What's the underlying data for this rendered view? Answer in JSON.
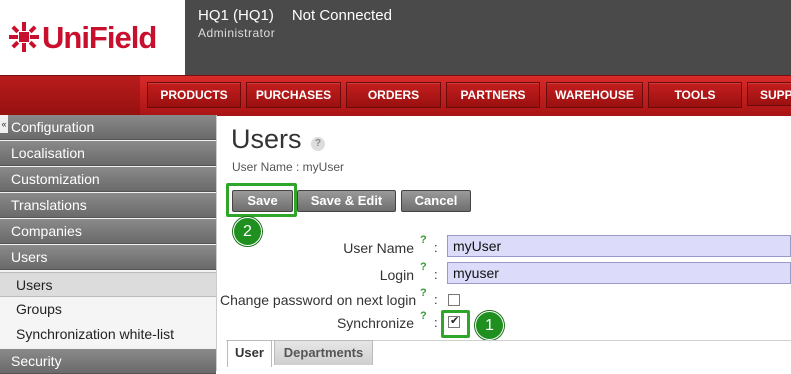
{
  "header": {
    "brand": "UniField",
    "instance": "HQ1 (HQ1)",
    "connection_status": "Not Connected",
    "user": "Administrator",
    "brand_color": "#c8102e"
  },
  "menu": {
    "items": [
      "PRODUCTS",
      "PURCHASES",
      "ORDERS",
      "PARTNERS",
      "WAREHOUSE",
      "TOOLS",
      "SUPP"
    ]
  },
  "sidebar": {
    "collapse_icon": "double-chevron-left-icon",
    "items": [
      {
        "label": "Configuration"
      },
      {
        "label": "Localisation"
      },
      {
        "label": "Customization"
      },
      {
        "label": "Translations"
      },
      {
        "label": "Companies"
      },
      {
        "label": "Users"
      }
    ],
    "sub_items": [
      {
        "label": "Users",
        "active": true
      },
      {
        "label": "Groups",
        "active": false
      },
      {
        "label": "Synchronization white-list",
        "active": false
      }
    ],
    "bottom_item": {
      "label": "Security"
    }
  },
  "page": {
    "title": "Users",
    "help_icon": "question-circle-icon",
    "subtitle": "User Name : myUser"
  },
  "toolbar": {
    "save_label": "Save",
    "save_edit_label": "Save & Edit",
    "cancel_label": "Cancel"
  },
  "annotations": {
    "step1": "1",
    "step2": "2",
    "highlight_color": "#2fa52a"
  },
  "form": {
    "help_mark": "?",
    "colon": ":",
    "user_name": {
      "label": "User Name",
      "value": "myUser"
    },
    "login": {
      "label": "Login",
      "value": "myuser"
    },
    "change_password": {
      "label": "Change password on next login",
      "checked": false
    },
    "synchronize": {
      "label": "Synchronize",
      "checked": true
    }
  },
  "tabs": [
    {
      "label": "User",
      "active": true
    },
    {
      "label": "Departments",
      "active": false
    }
  ]
}
